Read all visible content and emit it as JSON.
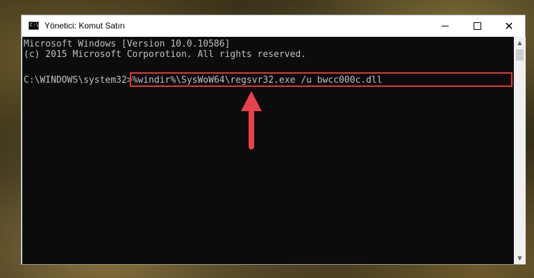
{
  "window": {
    "title": "Yönetici: Komut Satırı",
    "icon": "cmd-icon",
    "controls": {
      "minimize": "minimize-icon",
      "maximize": "maximize-icon",
      "close": "close-icon"
    }
  },
  "console": {
    "line1": "Microsoft Windows [Version 10.0.10586]",
    "line2": "(c) 2015 Microsoft Corporotion. All rights reserved.",
    "prompt": "C:\\WINDOWS\\system32>",
    "command": "%windir%\\SysWoW64\\regsvr32.exe /u bwcc000c.dll"
  },
  "colors": {
    "console_bg": "#0c0c0c",
    "console_text": "#c0c0c0",
    "highlight": "#e8353a",
    "arrow": "#e8434a"
  }
}
